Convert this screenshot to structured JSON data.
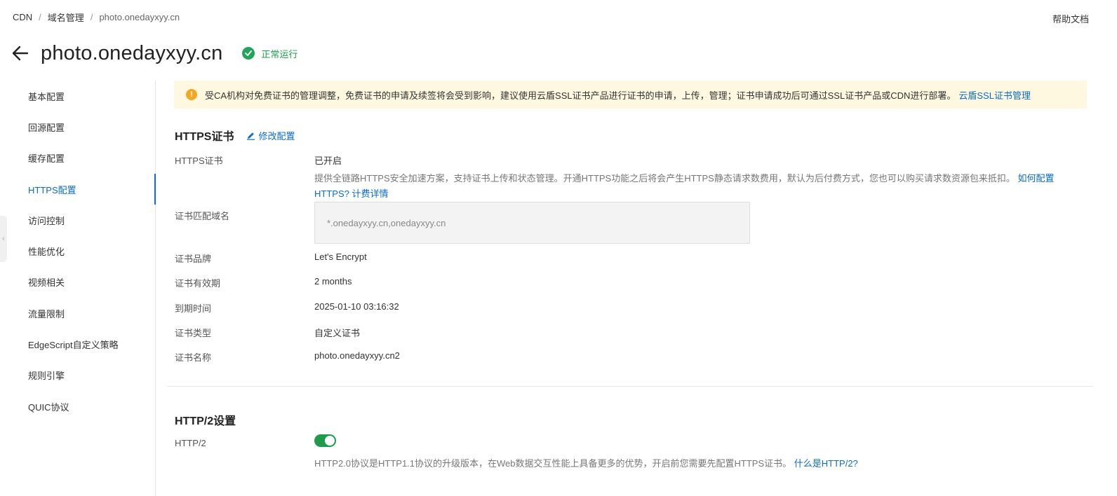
{
  "breadcrumb": {
    "items": [
      "CDN",
      "域名管理",
      "photo.onedayxyy.cn"
    ],
    "separator": "/"
  },
  "help": {
    "label": "帮助文档"
  },
  "header": {
    "title": "photo.onedayxyy.cn",
    "status": "正常运行",
    "status_color": "#22a55a"
  },
  "sidebar": {
    "items": [
      {
        "label": "基本配置"
      },
      {
        "label": "回源配置"
      },
      {
        "label": "缓存配置"
      },
      {
        "label": "HTTPS配置"
      },
      {
        "label": "访问控制"
      },
      {
        "label": "性能优化"
      },
      {
        "label": "视频相关"
      },
      {
        "label": "流量限制"
      },
      {
        "label": "EdgeScript自定义策略"
      },
      {
        "label": "规则引擎"
      },
      {
        "label": "QUIC协议"
      }
    ],
    "active_index": 3
  },
  "alert": {
    "text": "受CA机构对免费证书的管理调整，免费证书的申请及续签将会受到影响，建议使用云盾SSL证书产品进行证书的申请，上传，管理；证书申请成功后可通过SSL证书产品或CDN进行部署。",
    "link": "云盾SSL证书管理"
  },
  "https": {
    "title": "HTTPS证书",
    "edit_label": "修改配置",
    "rows": {
      "https_label": "HTTPS证书",
      "https_value": "已开启",
      "desc_text": "提供全链路HTTPS安全加速方案，支持证书上传和状态管理。开通HTTPS功能之后将会产生HTTPS静态请求数费用，默认为后付费方式，您也可以购买请求数资源包来抵扣。",
      "desc_link1": "如何配置HTTPS?",
      "desc_link2": "计费详情",
      "domain_label": "证书匹配域名",
      "domain_value": "*.onedayxyy.cn,onedayxyy.cn",
      "brand_label": "证书品牌",
      "brand_value": "Let's Encrypt",
      "validity_label": "证书有效期",
      "validity_value": "2 months",
      "expire_label": "到期时间",
      "expire_value": "2025-01-10 03:16:32",
      "type_label": "证书类型",
      "type_value": "自定义证书",
      "name_label": "证书名称",
      "name_value": "photo.onedayxyy.cn2"
    }
  },
  "http2": {
    "title": "HTTP/2设置",
    "label": "HTTP/2",
    "enabled": true,
    "desc": "HTTP2.0协议是HTTP1.1协议的升级版本，在Web数据交互性能上具备更多的优势，开启前您需要先配置HTTPS证书。",
    "link": "什么是HTTP/2?"
  },
  "colors": {
    "accent": "#0b6bc9",
    "success": "#1e9b4b",
    "warning_bg": "#fff8e0",
    "warning_icon": "#f5a623"
  }
}
